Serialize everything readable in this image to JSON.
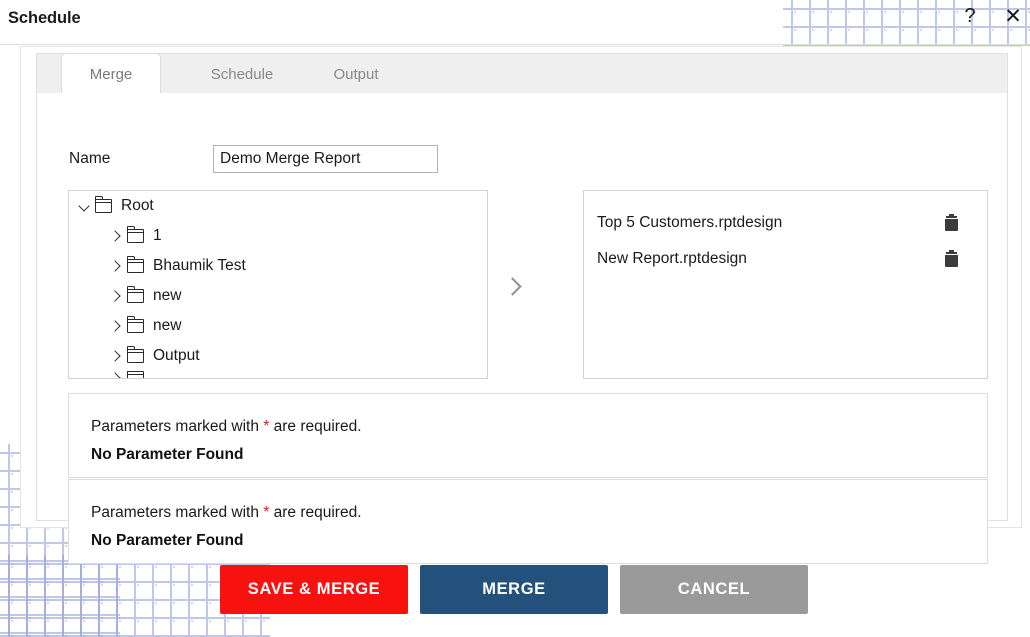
{
  "window": {
    "title": "Schedule",
    "help_icon": "question-mark-icon",
    "help_label": "?",
    "close_icon": "close-icon",
    "close_label": "✕"
  },
  "tabs": [
    {
      "id": "merge",
      "label": "Merge",
      "active": true
    },
    {
      "id": "schedule",
      "label": "Schedule",
      "active": false
    },
    {
      "id": "output",
      "label": "Output",
      "active": false
    }
  ],
  "form": {
    "name_label": "Name",
    "name_value": "Demo Merge Report",
    "name_placeholder": "Name"
  },
  "tree": {
    "root": {
      "label": "Root",
      "expanded": true,
      "caret": "chevron-down-icon",
      "icon": "folder-icon"
    },
    "children": [
      {
        "label": "1",
        "expanded": false,
        "caret": "chevron-right-icon",
        "icon": "folder-icon"
      },
      {
        "label": "Bhaumik Test",
        "expanded": false,
        "caret": "chevron-right-icon",
        "icon": "folder-icon"
      },
      {
        "label": "new",
        "expanded": false,
        "caret": "chevron-right-icon",
        "icon": "folder-icon"
      },
      {
        "label": "new",
        "expanded": false,
        "caret": "chevron-right-icon",
        "icon": "folder-icon"
      },
      {
        "label": "Output",
        "expanded": false,
        "caret": "chevron-right-icon",
        "icon": "folder-icon"
      }
    ]
  },
  "transfer": {
    "icon": "chevron-right-icon"
  },
  "reports": {
    "items": [
      {
        "name": "Top 5 Customers.rptdesign",
        "delete_icon": "trash-icon"
      },
      {
        "name": "New Report.rptdesign",
        "delete_icon": "trash-icon"
      }
    ]
  },
  "parameters": [
    {
      "note_prefix": "Parameters marked with ",
      "note_star": "*",
      "note_suffix": " are required.",
      "result": "No Parameter Found"
    },
    {
      "note_prefix": "Parameters marked with ",
      "note_star": "*",
      "note_suffix": " are required.",
      "result": "No Parameter Found"
    }
  ],
  "footer": {
    "save_merge_label": "SAVE & MERGE",
    "merge_label": "MERGE",
    "cancel_label": "CANCEL"
  },
  "colors": {
    "save_merge": "#f71210",
    "merge": "#24517c",
    "cancel": "#9a9a9a",
    "required_star": "#e02020",
    "tab_strip_bg": "#efefef",
    "dot_pattern": "#8e9cd4"
  }
}
